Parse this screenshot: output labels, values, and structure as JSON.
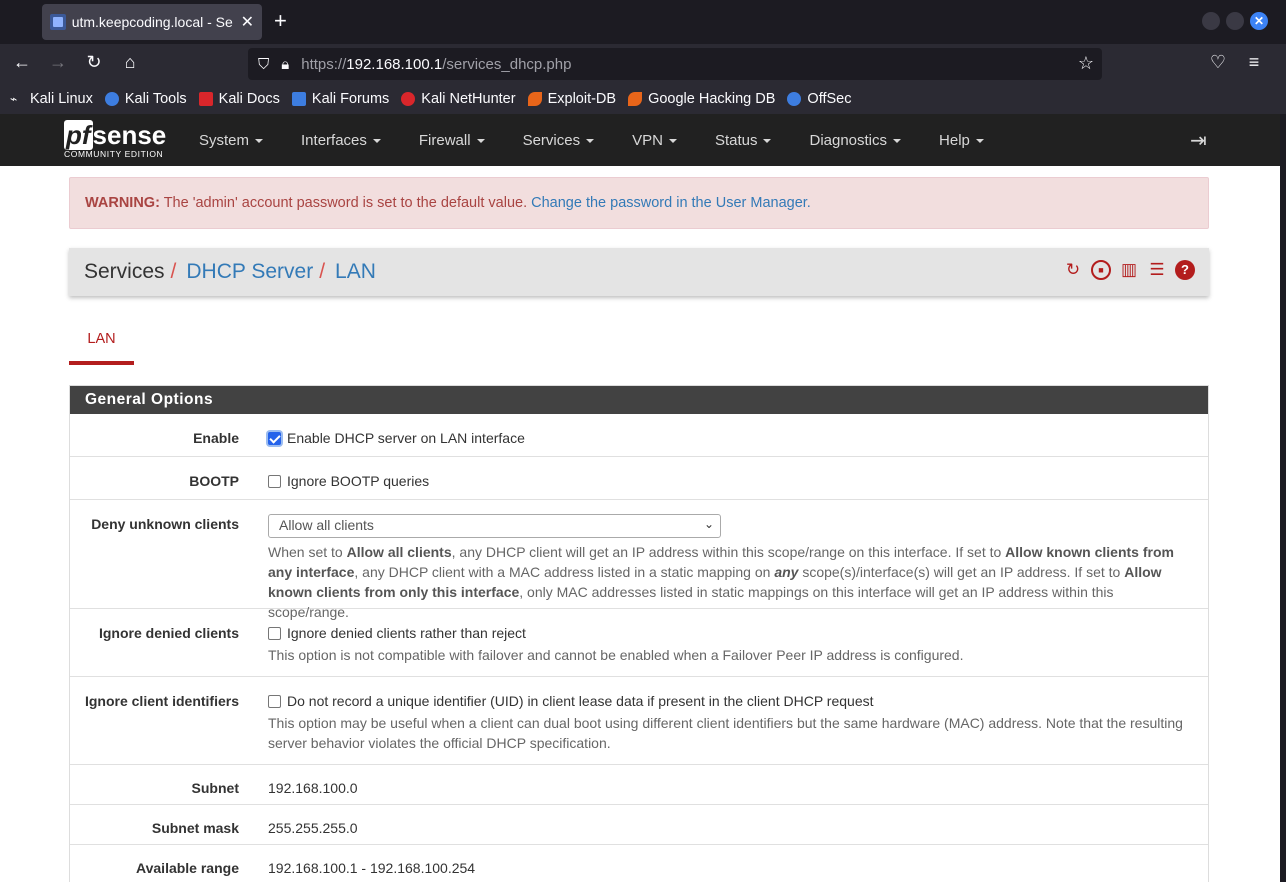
{
  "browser": {
    "tab_title": "utm.keepcoding.local - Se",
    "url_scheme": "https://",
    "url_host": "192.168.100.1",
    "url_path": "/services_dhcp.php",
    "bookmarks": [
      {
        "label": "Kali Linux",
        "color": "#ffffff"
      },
      {
        "label": "Kali Tools",
        "color": "#3d7de0"
      },
      {
        "label": "Kali Docs",
        "color": "#d9262b"
      },
      {
        "label": "Kali Forums",
        "color": "#3d7de0"
      },
      {
        "label": "Kali NetHunter",
        "color": "#d9262b"
      },
      {
        "label": "Exploit-DB",
        "color": "#e8651a"
      },
      {
        "label": "Google Hacking DB",
        "color": "#e8651a"
      },
      {
        "label": "OffSec",
        "color": "#3d7de0"
      }
    ]
  },
  "pfsense": {
    "logo_pf": "pf",
    "logo_sense": "sense",
    "logo_sub": "COMMUNITY EDITION",
    "menu": [
      "System",
      "Interfaces",
      "Firewall",
      "Services",
      "VPN",
      "Status",
      "Diagnostics",
      "Help"
    ]
  },
  "alert": {
    "label": "WARNING:",
    "text": " The 'admin' account password is set to the default value. ",
    "link": "Change the password in the User Manager."
  },
  "breadcrumb": {
    "root": "Services",
    "sep": "/",
    "level1": "DHCP Server",
    "level2": "LAN"
  },
  "tabs": {
    "active": "LAN"
  },
  "panel": {
    "title": "General Options",
    "enable": {
      "label": "Enable",
      "checkbox": "Enable DHCP server on LAN interface",
      "checked": true
    },
    "bootp": {
      "label": "BOOTP",
      "checkbox": "Ignore BOOTP queries",
      "checked": false
    },
    "deny_unknown": {
      "label": "Deny unknown clients",
      "selected": "Allow all clients",
      "help_1": "When set to ",
      "help_b1": "Allow all clients",
      "help_2": ", any DHCP client will get an IP address within this scope/range on this interface. If set to ",
      "help_b2": "Allow known clients from any interface",
      "help_3": ", any DHCP client with a MAC address listed in a static mapping on ",
      "help_b3": "any",
      "help_4": " scope(s)/interface(s) will get an IP address. If set to ",
      "help_b4": "Allow known clients from only this interface",
      "help_5": ", only MAC addresses listed in static mappings on this interface will get an IP address within this scope/range."
    },
    "ignore_denied": {
      "label": "Ignore denied clients",
      "checkbox": "Ignore denied clients rather than reject",
      "checked": false,
      "help": "This option is not compatible with failover and cannot be enabled when a Failover Peer IP address is configured."
    },
    "ignore_ident": {
      "label": "Ignore client identifiers",
      "checkbox": "Do not record a unique identifier (UID) in client lease data if present in the client DHCP request",
      "checked": false,
      "help": "This option may be useful when a client can dual boot using different client identifiers but the same hardware (MAC) address. Note that the resulting server behavior violates the official DHCP specification."
    },
    "subnet": {
      "label": "Subnet",
      "value": "192.168.100.0"
    },
    "subnet_mask": {
      "label": "Subnet mask",
      "value": "255.255.255.0"
    },
    "available_range": {
      "label": "Available range",
      "value": "192.168.100.1 - 192.168.100.254"
    }
  },
  "colors": {
    "accent": "#b31d1d",
    "link": "#337ab7",
    "panel_head": "#424242"
  }
}
